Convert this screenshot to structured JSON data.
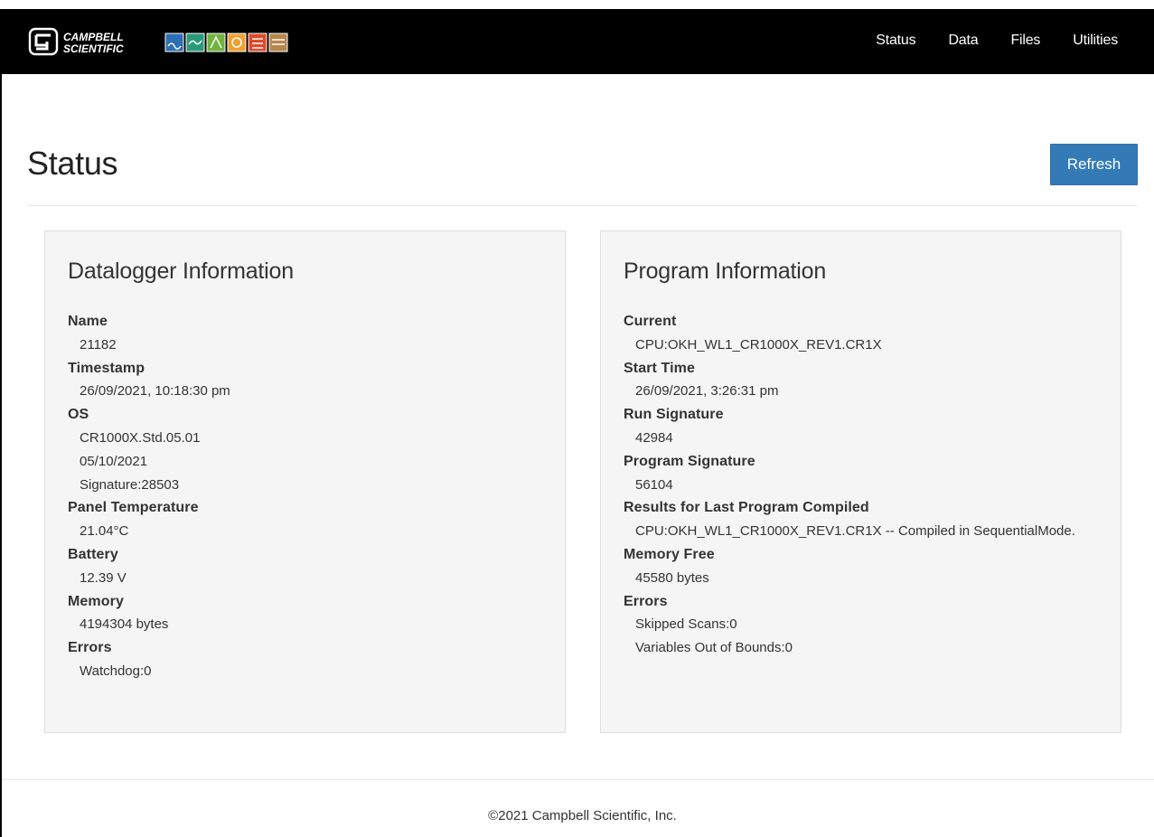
{
  "header": {
    "logo_line1": "CAMPBELL",
    "logo_line2": "SCIENTIFIC",
    "nav": [
      "Status",
      "Data",
      "Files",
      "Utilities"
    ]
  },
  "page": {
    "title": "Status",
    "refresh_label": "Refresh"
  },
  "datalogger": {
    "title": "Datalogger Information",
    "fields": [
      {
        "label": "Name",
        "values": [
          "21182"
        ]
      },
      {
        "label": "Timestamp",
        "values": [
          "26/09/2021, 10:18:30 pm"
        ]
      },
      {
        "label": "OS",
        "values": [
          "CR1000X.Std.05.01",
          "05/10/2021",
          "Signature:28503"
        ]
      },
      {
        "label": "Panel Temperature",
        "values": [
          "21.04°C"
        ]
      },
      {
        "label": "Battery",
        "values": [
          "12.39 V"
        ]
      },
      {
        "label": "Memory",
        "values": [
          "4194304 bytes"
        ]
      },
      {
        "label": "Errors",
        "values": [
          "Watchdog:0"
        ]
      }
    ]
  },
  "program": {
    "title": "Program Information",
    "fields": [
      {
        "label": "Current",
        "values": [
          "CPU:OKH_WL1_CR1000X_REV1.CR1X"
        ]
      },
      {
        "label": "Start Time",
        "values": [
          "26/09/2021, 3:26:31 pm"
        ]
      },
      {
        "label": "Run Signature",
        "values": [
          "42984"
        ]
      },
      {
        "label": "Program Signature",
        "values": [
          "56104"
        ]
      },
      {
        "label": "Results for Last Program Compiled",
        "values": [
          "CPU:OKH_WL1_CR1000X_REV1.CR1X -- Compiled in SequentialMode."
        ]
      },
      {
        "label": "Memory Free",
        "values": [
          "45580 bytes"
        ]
      },
      {
        "label": "Errors",
        "values": [
          "Skipped Scans:0",
          "Variables Out of Bounds:0"
        ]
      }
    ]
  },
  "footer": {
    "text": "©2021 Campbell Scientific, Inc."
  },
  "colors": {
    "navbar": "#000000",
    "primary_button": "#337ab7",
    "panel_bg": "#f5f5f5"
  }
}
